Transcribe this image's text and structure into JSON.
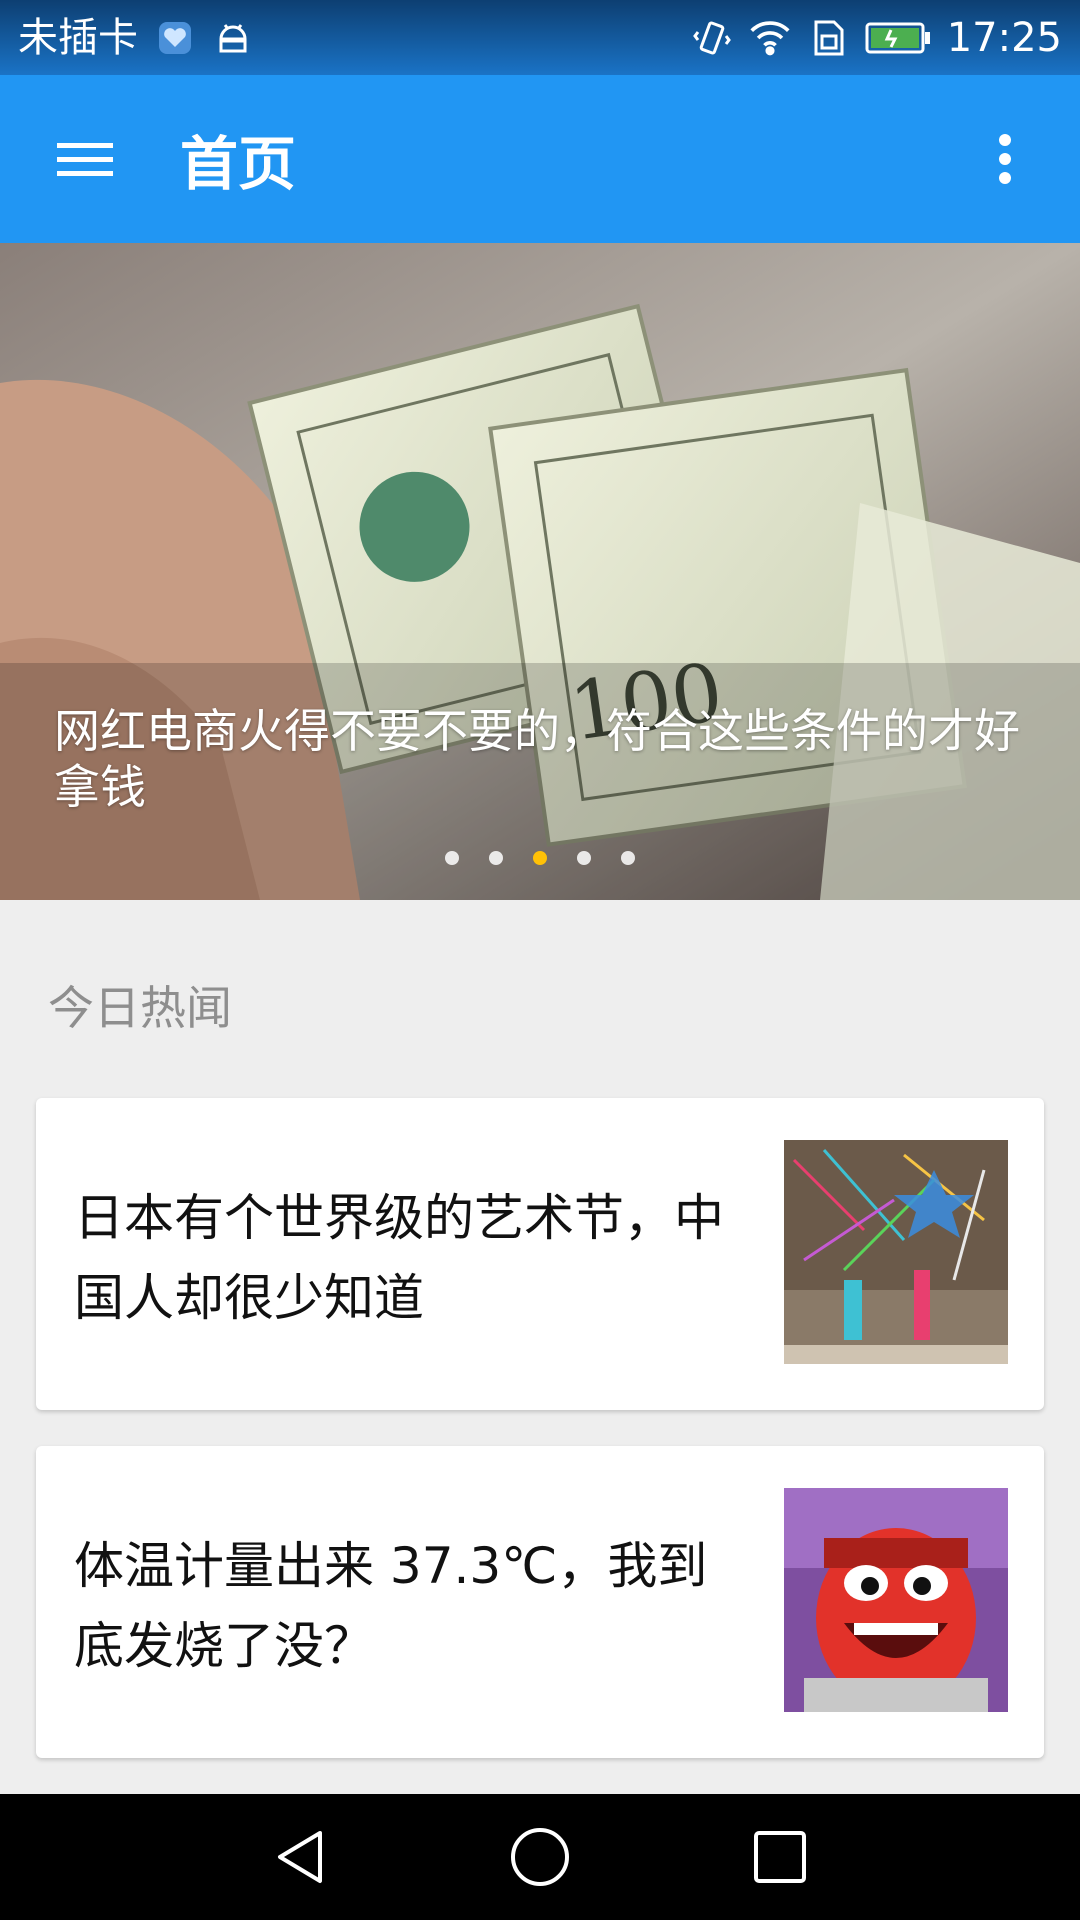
{
  "status_bar": {
    "carrier": "未插卡",
    "time": "17:25",
    "icons": [
      "health-icon",
      "android-icon",
      "vibrate-icon",
      "wifi-icon",
      "sim-icon",
      "battery-charging-icon"
    ]
  },
  "app_bar": {
    "title": "首页",
    "menu_icon": "menu-icon",
    "overflow_icon": "more-vert-icon",
    "color": "#2196f3"
  },
  "banner": {
    "caption": "网红电商火得不要不要的，符合这些条件的才好拿钱",
    "indicator_count": 5,
    "active_index": 2,
    "active_color": "#ffc107"
  },
  "section": {
    "title": "今日热闻"
  },
  "news": [
    {
      "title": "日本有个世界级的艺术节，中国人却很少知道"
    },
    {
      "title": "体温计量出来 37.3℃，我到底发烧了没？"
    }
  ],
  "nav_bar": {
    "back_icon": "back-icon",
    "home_icon": "home-icon",
    "recents_icon": "recents-icon"
  }
}
